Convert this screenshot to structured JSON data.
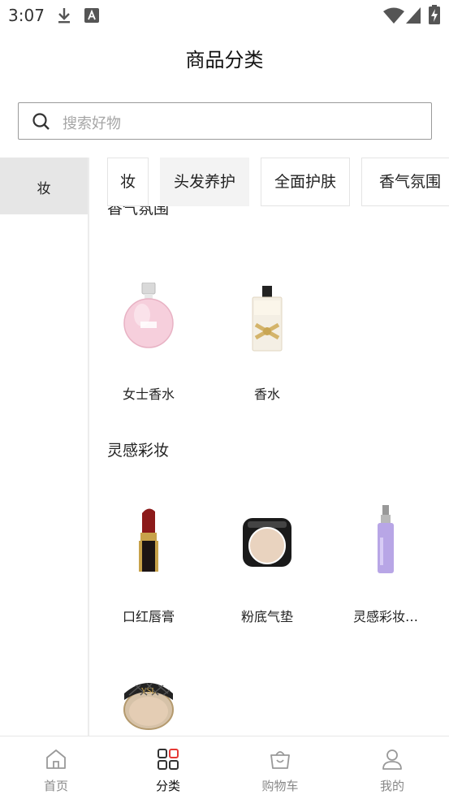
{
  "status_bar": {
    "time": "3:07"
  },
  "header": {
    "title": "商品分类"
  },
  "search": {
    "placeholder": "搜索好物"
  },
  "sidebar": {
    "items": [
      {
        "label": "妆",
        "selected": true
      }
    ]
  },
  "tabs": [
    {
      "label": "妆",
      "active": false
    },
    {
      "label": "头发养护",
      "active": true
    },
    {
      "label": "全面护肤",
      "active": false
    },
    {
      "label": "香气氛围",
      "active": false
    }
  ],
  "sections": [
    {
      "title": "香气氛围",
      "products": [
        {
          "name": "女士香水",
          "icon": "pink-perfume-bottle"
        },
        {
          "name": "香水",
          "icon": "gold-bow-perfume-bottle"
        }
      ]
    },
    {
      "title": "灵感彩妆",
      "products": [
        {
          "name": "口红唇膏",
          "icon": "lipstick"
        },
        {
          "name": "粉底气垫",
          "icon": "cushion-compact"
        },
        {
          "name": "灵感彩妆…",
          "icon": "serum-bottle"
        },
        {
          "name": "",
          "icon": "quilted-cushion-compact"
        }
      ]
    }
  ],
  "bottom_nav": {
    "items": [
      {
        "label": "首页",
        "icon": "home-icon",
        "active": false
      },
      {
        "label": "分类",
        "icon": "category-grid-icon",
        "active": true
      },
      {
        "label": "购物车",
        "icon": "shopping-basket-icon",
        "active": false
      },
      {
        "label": "我的",
        "icon": "user-icon",
        "active": false
      }
    ]
  },
  "colors": {
    "accent_red": "#e53935",
    "selected_bg": "#e6e6e6",
    "text": "#222222",
    "muted": "#888888"
  }
}
